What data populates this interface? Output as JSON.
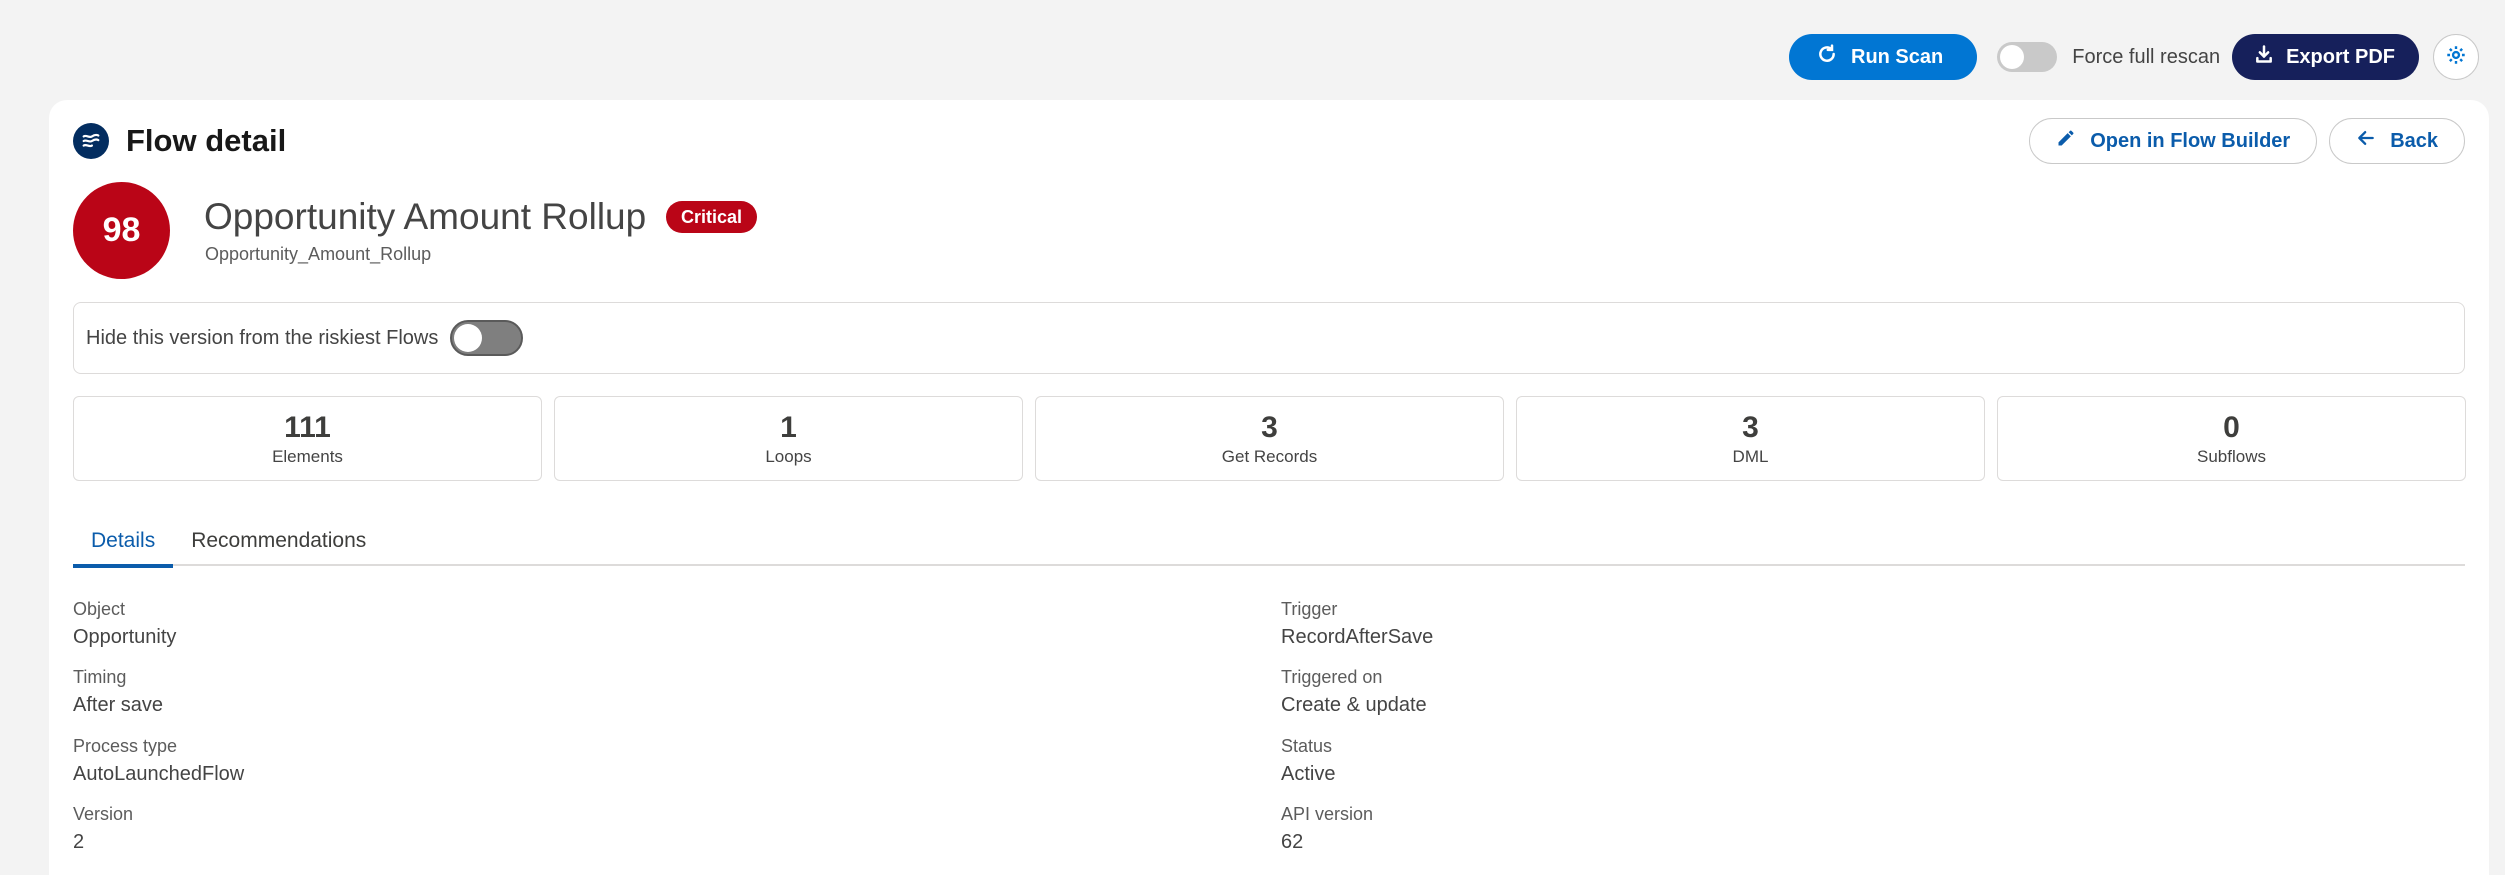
{
  "toolbar": {
    "run_scan_label": "Run Scan",
    "force_rescan_label": "Force full rescan",
    "force_rescan_on": false,
    "export_label": "Export PDF"
  },
  "header": {
    "title": "Flow detail",
    "open_builder_label": "Open in Flow Builder",
    "back_label": "Back"
  },
  "flow": {
    "score": "98",
    "name": "Opportunity Amount Rollup",
    "severity": "Critical",
    "api_name": "Opportunity_Amount_Rollup"
  },
  "hide": {
    "label": "Hide this version from the riskiest Flows",
    "on": false
  },
  "stats": [
    {
      "value": "111",
      "label": "Elements"
    },
    {
      "value": "1",
      "label": "Loops"
    },
    {
      "value": "3",
      "label": "Get Records"
    },
    {
      "value": "3",
      "label": "DML"
    },
    {
      "value": "0",
      "label": "Subflows"
    }
  ],
  "tabs": [
    {
      "label": "Details",
      "active": true
    },
    {
      "label": "Recommendations",
      "active": false
    }
  ],
  "details": {
    "left": [
      {
        "label": "Object",
        "value": "Opportunity"
      },
      {
        "label": "Timing",
        "value": "After save"
      },
      {
        "label": "Process type",
        "value": "AutoLaunchedFlow"
      },
      {
        "label": "Version",
        "value": "2"
      }
    ],
    "right": [
      {
        "label": "Trigger",
        "value": "RecordAfterSave"
      },
      {
        "label": "Triggered on",
        "value": "Create & update"
      },
      {
        "label": "Status",
        "value": "Active"
      },
      {
        "label": "API version",
        "value": "62"
      }
    ]
  },
  "colors": {
    "primary": "#0176d3",
    "navy": "#16205b",
    "critical": "#ba0517",
    "link": "#0b5cab"
  },
  "icons": {
    "run_scan": "refresh-icon",
    "export": "download-icon",
    "settings": "gear-icon",
    "flow": "flow-icon",
    "edit": "pencil-icon",
    "back": "arrow-left-icon"
  }
}
